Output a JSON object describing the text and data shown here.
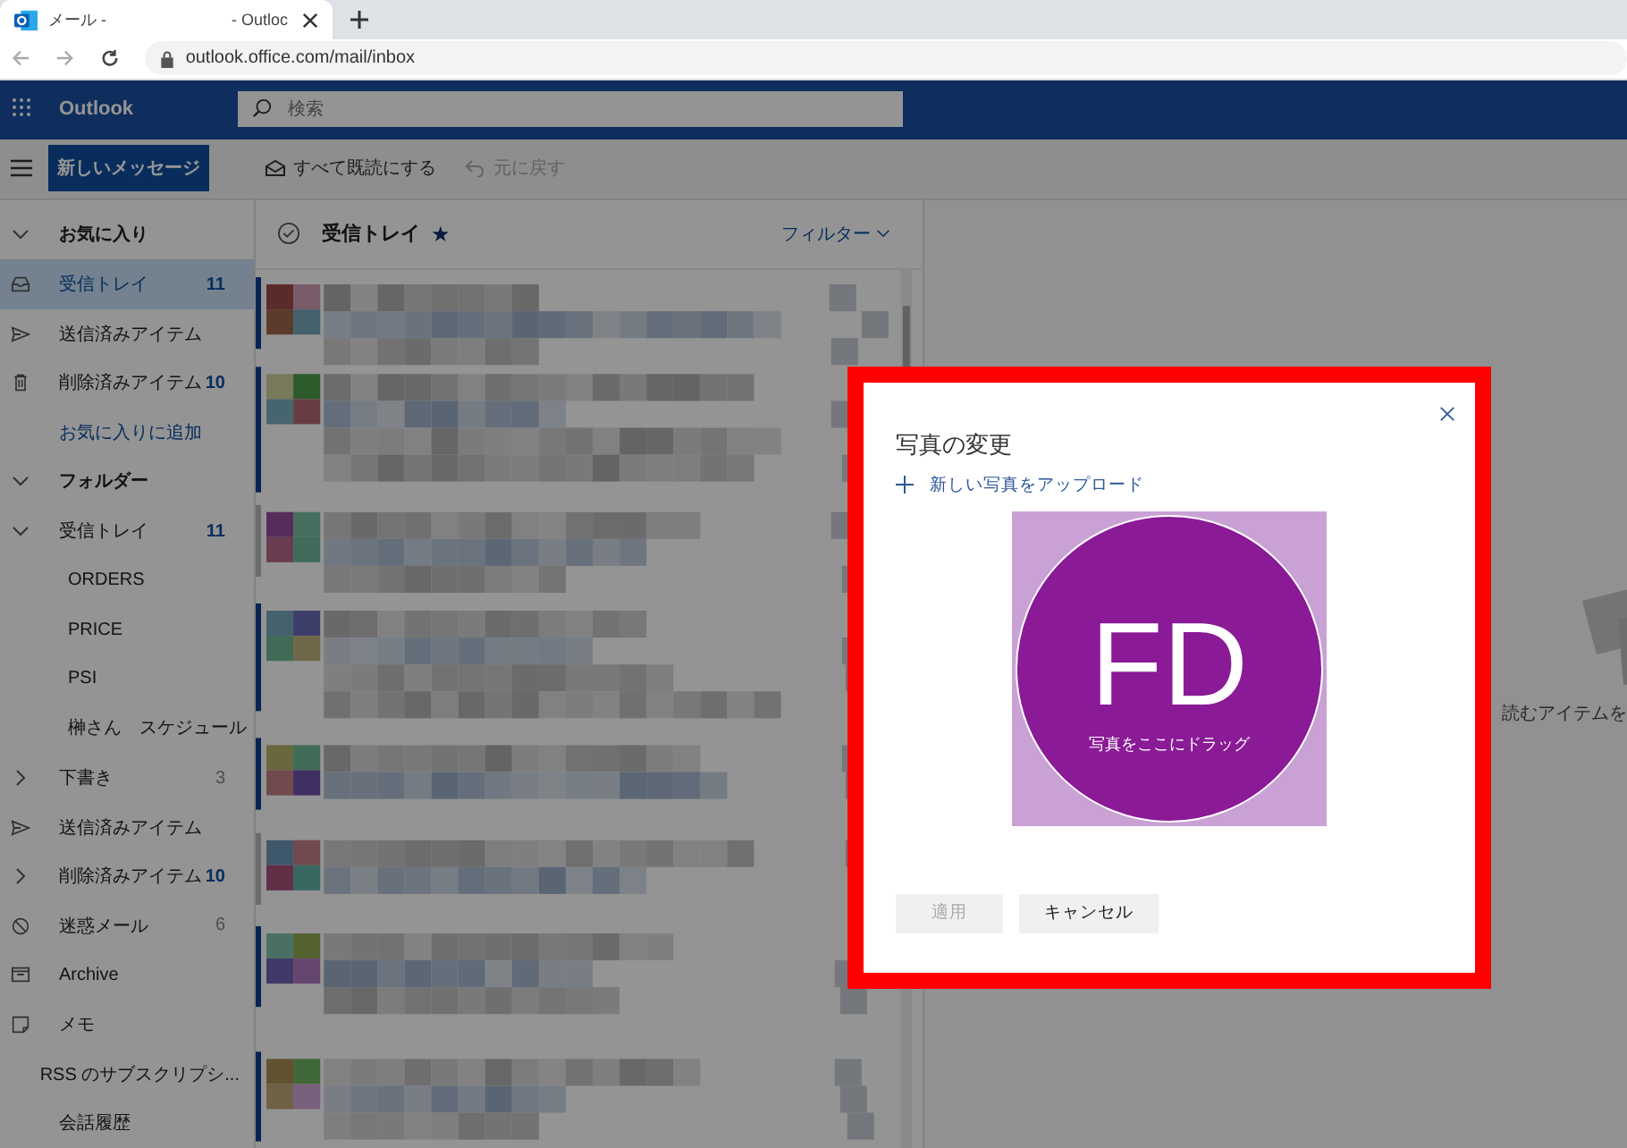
{
  "browser": {
    "tab": {
      "title": [
        "メール -",
        "- Outloc"
      ]
    },
    "url": "outlook.office.com/mail/inbox"
  },
  "header": {
    "app_name": "Outlook",
    "search": {
      "placeholder": "検索"
    }
  },
  "toolbar": {
    "new_message": "新しいメッセージ",
    "actions": [
      {
        "label": "すべて既読にする",
        "kind": "mark-read",
        "disabled": false
      },
      {
        "label": "元に戻す",
        "kind": "undo",
        "disabled": true
      }
    ]
  },
  "sidebar": {
    "items": [
      {
        "kind": "section",
        "label": "お気に入り",
        "expanded": true,
        "selected": false
      },
      {
        "kind": "inbox",
        "label": "受信トレイ",
        "count": "11",
        "count_bold": true,
        "selected": true
      },
      {
        "kind": "sent",
        "label": "送信済みアイテム",
        "selected": false
      },
      {
        "kind": "deleted",
        "label": "削除済みアイテム",
        "count": "10",
        "count_bold": true,
        "selected": false
      },
      {
        "kind": "link",
        "label": "お気に入りに追加",
        "selected": false
      },
      {
        "kind": "section",
        "label": "フォルダー",
        "expanded": true,
        "selected": false
      },
      {
        "kind": "folder",
        "label": "受信トレイ",
        "count": "11",
        "count_bold": true,
        "expanded": true,
        "selected": false,
        "children": [
          {
            "label": "ORDERS",
            "selected": false
          },
          {
            "label": "PRICE",
            "selected": false
          },
          {
            "label": "PSI",
            "selected": false
          },
          {
            "label": "榊さん　スケジュール",
            "selected": false
          }
        ]
      },
      {
        "kind": "folder",
        "label": "下書き",
        "count": "3",
        "count_bold": false,
        "expanded": false,
        "selected": false
      },
      {
        "kind": "sent",
        "label": "送信済みアイテム",
        "selected": false
      },
      {
        "kind": "folder",
        "label": "削除済みアイテム",
        "count": "10",
        "count_bold": true,
        "expanded": false,
        "selected": false
      },
      {
        "kind": "junk",
        "label": "迷惑メール",
        "count": "6",
        "count_bold": false,
        "selected": false
      },
      {
        "kind": "archive",
        "label": "Archive",
        "selected": false
      },
      {
        "kind": "note",
        "label": "メモ",
        "selected": false
      },
      {
        "kind": "plain",
        "label": "RSS のサブスクリプシ...",
        "selected": false
      },
      {
        "kind": "plain",
        "label": "会話履歴",
        "selected": false
      }
    ]
  },
  "message_list": {
    "title": "受信トレイ",
    "favorite": "★",
    "filter": "フィルター"
  },
  "reading_pane": {
    "hint": "読むアイテムを"
  },
  "dialog": {
    "dimmed": true,
    "title": "写真の変更",
    "upload": "新しい写真をアップロード",
    "initials": "FD",
    "drop_hint": "写真をここにドラッグ",
    "buttons": [
      {
        "label": "適用",
        "disabled": true
      },
      {
        "label": "キャンセル",
        "disabled": false
      }
    ]
  }
}
